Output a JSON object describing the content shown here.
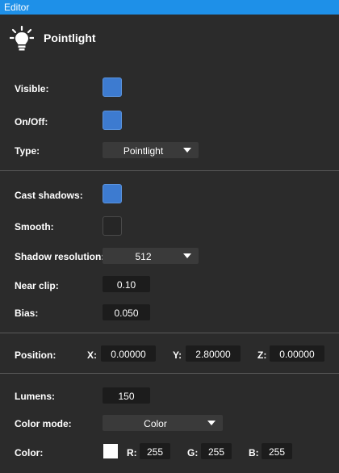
{
  "window": {
    "title": "Editor"
  },
  "header": {
    "title": "Pointlight",
    "icon": "lightbulb-icon"
  },
  "light": {
    "visible_label": "Visible:",
    "visible": true,
    "onoff_label": "On/Off:",
    "onoff": true,
    "type_label": "Type:",
    "type_value": "Pointlight"
  },
  "shadows": {
    "cast_label": "Cast shadows:",
    "cast": true,
    "smooth_label": "Smooth:",
    "smooth": false,
    "resolution_label": "Shadow resolution:",
    "resolution_value": "512",
    "near_clip_label": "Near clip:",
    "near_clip": "0.10",
    "bias_label": "Bias:",
    "bias": "0.050"
  },
  "transform": {
    "position_label": "Position:",
    "x_label": "X:",
    "x": "0.00000",
    "y_label": "Y:",
    "y": "2.80000",
    "z_label": "Z:",
    "z": "0.00000"
  },
  "lighting": {
    "lumens_label": "Lumens:",
    "lumens": "150",
    "color_mode_label": "Color mode:",
    "color_mode": "Color",
    "color_label": "Color:",
    "color_hex": "#ffffff",
    "r_label": "R:",
    "r": "255",
    "g_label": "G:",
    "g": "255",
    "b_label": "B:",
    "b": "255"
  },
  "colors": {
    "titlebar": "#1e90e8",
    "background": "#2b2b2b",
    "checkbox_on": "#3d7bd0",
    "field": "#1c1c1c",
    "dropdown": "#3a3a3a"
  }
}
